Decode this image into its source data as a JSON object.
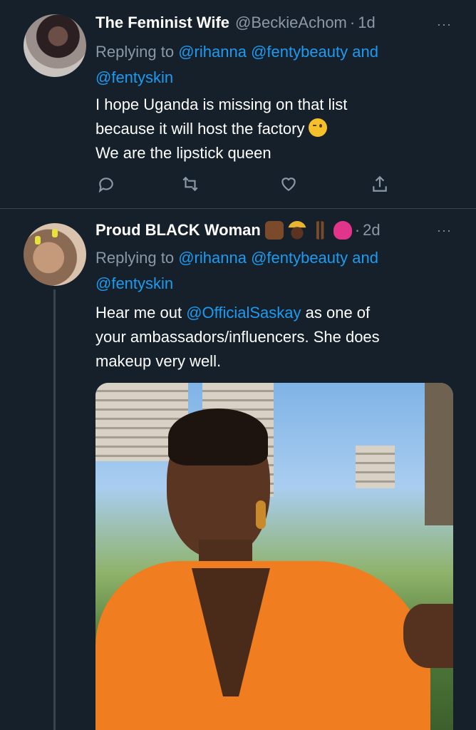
{
  "tweets": [
    {
      "display_name": "The Feminist Wife",
      "handle": "@BeckieAchom",
      "separator": "·",
      "time": "1d",
      "more_label": "···",
      "replying_prefix": "Replying to",
      "replying_mention_1": "@rihanna",
      "replying_mention_2": "@fentybeauty",
      "replying_and": "and",
      "replying_mention_3": "@fentyskin",
      "body_line_1": "I hope Uganda is missing on that list",
      "body_line_2": "because it will host the factory",
      "body_line_3": "We are the lipstick queen",
      "emoji_inline": "winking-face"
    },
    {
      "display_name": "Proud BLACK Woman",
      "name_emojis": [
        "raised-fist",
        "princess",
        "victory-hand",
        "growing-heart"
      ],
      "separator": "·",
      "time": "2d",
      "more_label": "···",
      "replying_prefix": "Replying to",
      "replying_mention_1": "@rihanna",
      "replying_mention_2": "@fentybeauty",
      "replying_and": "and",
      "replying_mention_3": "@fentyskin",
      "body_pre": "Hear me out",
      "body_mention": "@OfficialSaskay",
      "body_post_1": "as one of",
      "body_line_2": "your ambassadors/influencers. She does",
      "body_line_3": "makeup very well."
    }
  ],
  "actions": [
    "reply-icon",
    "retweet-icon",
    "like-icon",
    "share-icon"
  ],
  "colors": {
    "background": "#15202b",
    "text": "#ffffff",
    "muted": "#8b98a5",
    "accent": "#1d9bf0",
    "divider": "#38444d"
  }
}
